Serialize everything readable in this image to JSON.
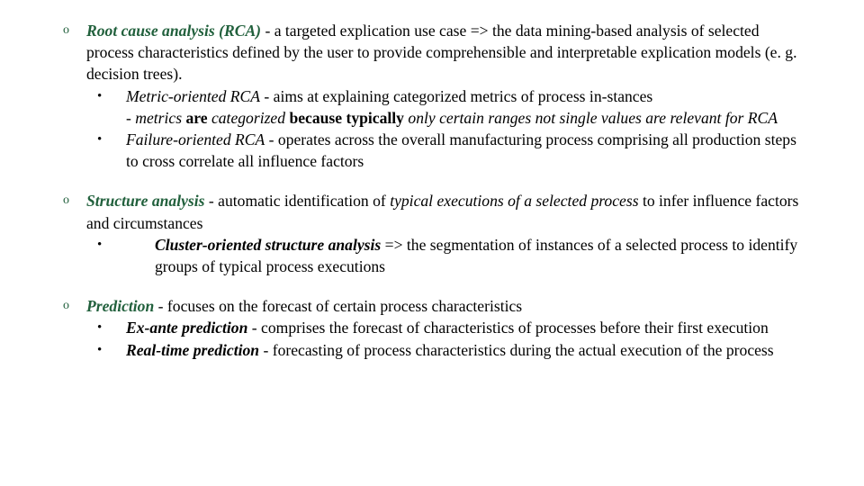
{
  "slide": {
    "markers": {
      "level1": "o",
      "level2": "•"
    },
    "colors": {
      "heading_green": "#21603C",
      "body_black": "#000000",
      "background": "#FFFFFF"
    },
    "blocks": [
      {
        "id": "root-cause-analysis",
        "marker": "o",
        "heading": "Root cause analysis (RCA)",
        "heading_style": "bold-italic-green",
        "body": " - a targeted explication use case => the data mining-based analysis of selected process characteristics defined by the user to provide comprehensible and interpretable explication models (e. g. decision trees).",
        "sub_items": [
          {
            "id": "metric-oriented-rca",
            "marker": "•",
            "heading": "Metric-oriented RCA",
            "heading_style": "italic-black",
            "body": " - aims at explaining categorized metrics of process in-stances",
            "note_runs": [
              {
                "text": "- metrics ",
                "style": "italic"
              },
              {
                "text": "are ",
                "style": "bold"
              },
              {
                "text": "categorized ",
                "style": "italic"
              },
              {
                "text": "because typically ",
                "style": "bold"
              },
              {
                "text": "only certain ranges not single values are relevant for RCA",
                "style": "italic"
              }
            ]
          },
          {
            "id": "failure-oriented-rca",
            "marker": "•",
            "heading": "Failure-oriented RCA",
            "heading_style": "italic-black",
            "body": " - operates across the overall manufacturing process comprising all production steps to cross correlate all influence factors"
          }
        ]
      },
      {
        "id": "structure-analysis",
        "marker": "o",
        "heading": "Structure analysis",
        "heading_style": "bold-italic-green",
        "body_runs": [
          {
            "text": " - automatic identification of ",
            "style": "normal"
          },
          {
            "text": "typical executions of a selected process",
            "style": "italic"
          },
          {
            "text": " to infer influence factors and circumstances",
            "style": "normal"
          }
        ],
        "sub_items": [
          {
            "id": "cluster-oriented-structure-analysis",
            "marker": "•",
            "heading": "Cluster-oriented structure analysis",
            "heading_style": "bold-italic-black",
            "body": " => the segmentation of instances of a selected process to identify groups of typical process executions"
          }
        ]
      },
      {
        "id": "prediction",
        "marker": "o",
        "heading": "Prediction",
        "heading_style": "bold-italic-green",
        "body": " - focuses on the forecast of certain process characteristics",
        "sub_items": [
          {
            "id": "ex-ante-prediction",
            "marker": "•",
            "heading": "Ex-ante prediction",
            "heading_style": "bold-italic-black",
            "body": " - comprises the forecast of characteristics of processes before their first execution"
          },
          {
            "id": "real-time-prediction",
            "marker": "•",
            "heading": "Real-time prediction",
            "heading_style": "bold-italic-black",
            "body": "  - forecasting of process characteristics during the actual execution of the process"
          }
        ]
      }
    ]
  }
}
